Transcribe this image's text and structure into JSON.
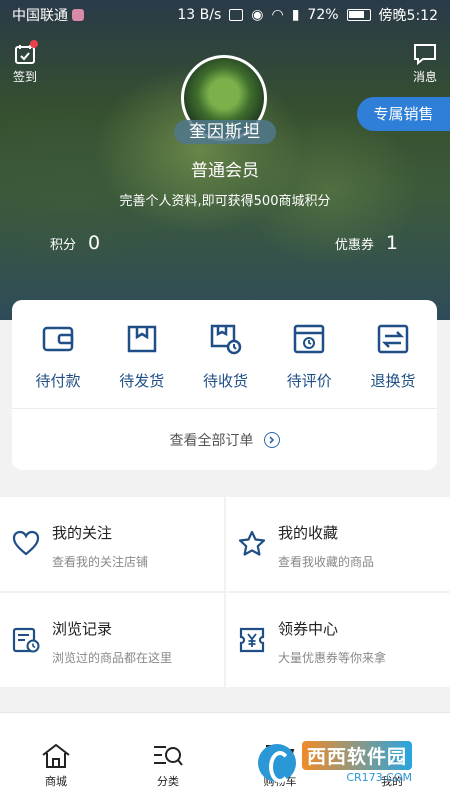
{
  "status_bar": {
    "carrier": "中国联通",
    "speed": "13 B/s",
    "battery": "72%",
    "time": "傍晚5:12"
  },
  "header": {
    "checkin_label": "签到",
    "messages_label": "消息",
    "username": "奎因斯坦",
    "member_level": "普通会员",
    "profile_hint": "完善个人资料,即可获得500商城积分",
    "points_label": "积分",
    "points_value": "0",
    "coupons_label": "优惠券",
    "coupons_value": "1",
    "vip_sales_button": "专属销售"
  },
  "orders": {
    "items": [
      {
        "label": "待付款",
        "icon": "wallet-icon"
      },
      {
        "label": "待发货",
        "icon": "box-icon"
      },
      {
        "label": "待收货",
        "icon": "delivery-icon"
      },
      {
        "label": "待评价",
        "icon": "review-icon"
      },
      {
        "label": "退换货",
        "icon": "exchange-icon"
      }
    ],
    "view_all": "查看全部订单"
  },
  "features": [
    {
      "title": "我的关注",
      "subtitle": "查看我的关注店铺",
      "icon": "heart-icon"
    },
    {
      "title": "我的收藏",
      "subtitle": "查看我收藏的商品",
      "icon": "star-icon"
    },
    {
      "title": "浏览记录",
      "subtitle": "浏览过的商品都在这里",
      "icon": "history-icon"
    },
    {
      "title": "领券中心",
      "subtitle": "大量优惠券等你来拿",
      "icon": "coupon-icon"
    }
  ],
  "tabbar": {
    "items": [
      {
        "label": "商城",
        "icon": "home-icon"
      },
      {
        "label": "分类",
        "icon": "category-search-icon"
      },
      {
        "label": "购物车",
        "icon": "cart-icon"
      },
      {
        "label": "我的",
        "icon": "user-icon"
      }
    ]
  },
  "watermark": {
    "brand": "西西软件园",
    "domain": "CR173.COM"
  },
  "colors": {
    "primary_blue": "#1f4f86",
    "vip_button": "#2f7fd9",
    "badge_red": "#e8414c"
  }
}
